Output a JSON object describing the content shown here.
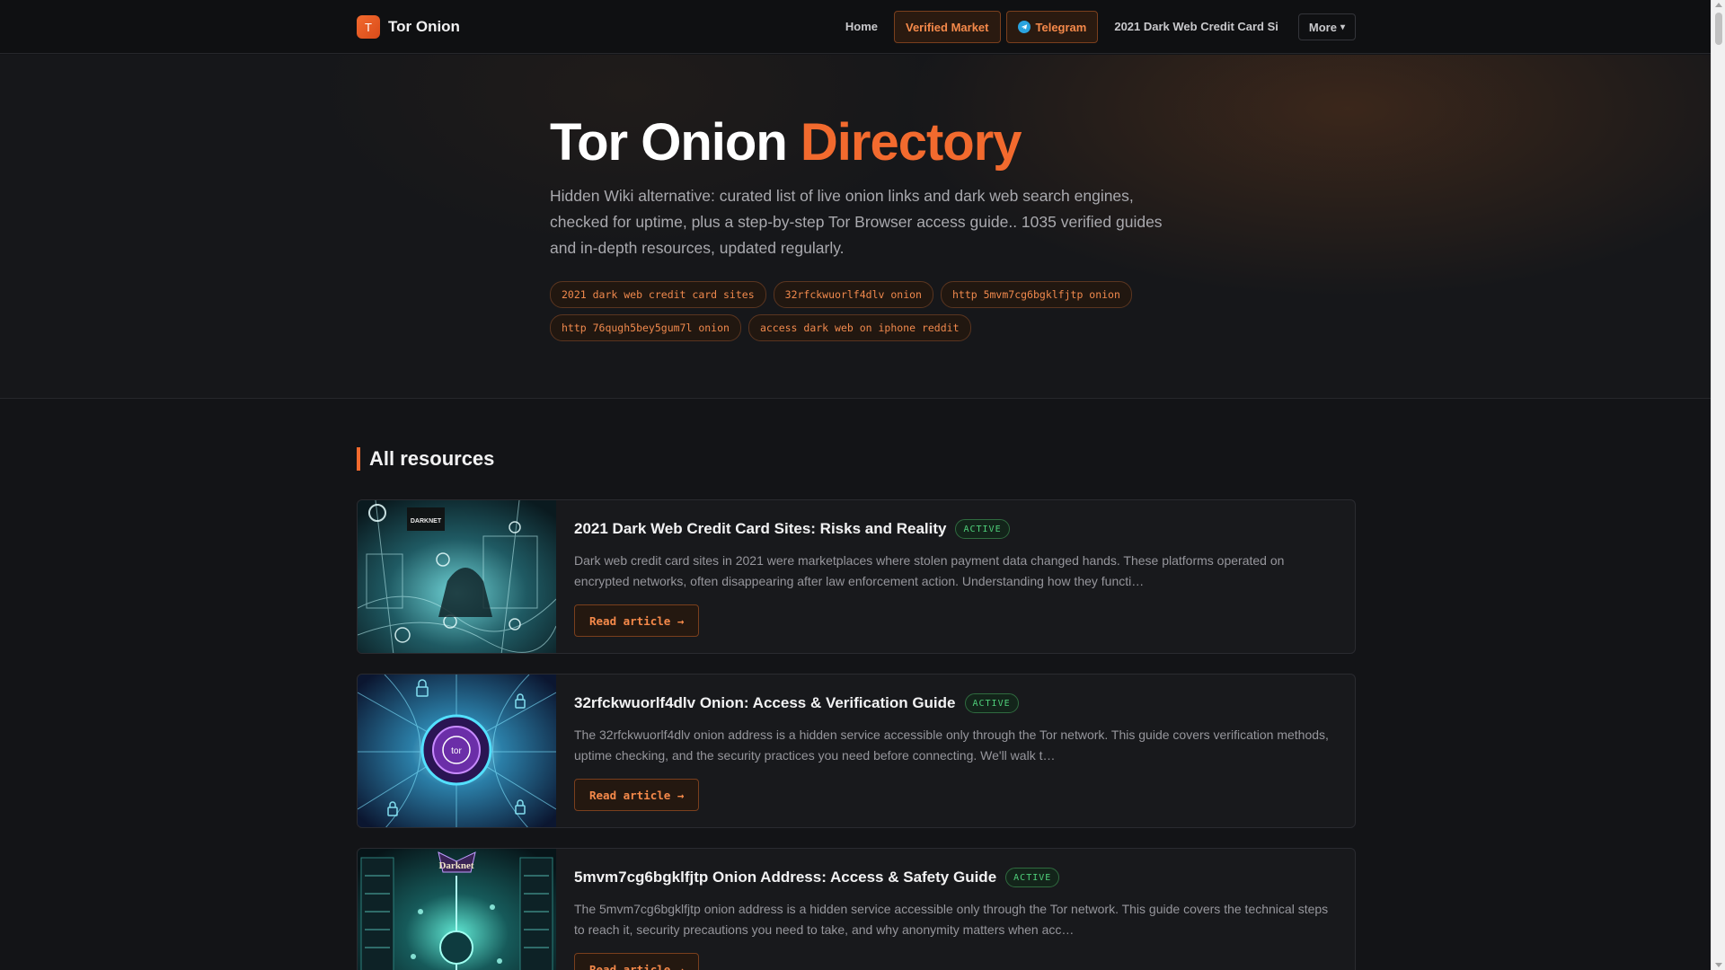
{
  "brand": {
    "logo_letter": "T",
    "name": "Tor Onion"
  },
  "nav": {
    "home": "Home",
    "verified_market": "Verified Market",
    "telegram": "Telegram",
    "truncated_link": "2021 Dark Web Credit Card Si",
    "more": "More",
    "more_arrow": "▾"
  },
  "hero": {
    "title_main": "Tor Onion",
    "title_accent": "Directory",
    "description": "Hidden Wiki alternative: curated list of live onion links and dark web search engines, checked for uptime, plus a step-by-step Tor Browser access guide.. 1035 verified guides and in-depth resources, updated regularly.",
    "tags": [
      "2021 dark web credit card sites",
      "32rfckwuorlf4dlv onion",
      "http 5mvm7cg6bgklfjtp onion",
      "http 76qugh5bey5gum7l onion",
      "access dark web on iphone reddit"
    ]
  },
  "resources": {
    "heading": "All resources",
    "items": [
      {
        "title": "2021 Dark Web Credit Card Sites: Risks and Reality",
        "status": "ACTIVE",
        "excerpt": "Dark web credit card sites in 2021 were marketplaces where stolen payment data changed hands. These platforms operated on encrypted networks, often disappearing after law enforcement action. Understanding how they functi…",
        "cta": "Read article →",
        "thumb_label": "DARKNET"
      },
      {
        "title": "32rfckwuorlf4dlv Onion: Access & Verification Guide",
        "status": "ACTIVE",
        "excerpt": "The 32rfckwuorlf4dlv onion address is a hidden service accessible only through the Tor network. This guide covers verification methods, uptime checking, and the security practices you need before connecting. We'll walk t…",
        "cta": "Read article →",
        "thumb_label": "tor"
      },
      {
        "title": "5mvm7cg6bgklfjtp Onion Address: Access & Safety Guide",
        "status": "ACTIVE",
        "excerpt": "The 5mvm7cg6bgklfjtp onion address is a hidden service accessible only through the Tor network. This guide covers the technical steps to reach it, security precautions you need to take, and why anonymity matters when acc…",
        "cta": "Read article →",
        "thumb_label": "Darknet"
      }
    ]
  },
  "colors": {
    "accent": "#f26a2e",
    "background": "#131417",
    "card": "#18191c",
    "status_active": "#4fd07a"
  },
  "icons": [
    "telegram-icon",
    "chevron-down-icon"
  ]
}
